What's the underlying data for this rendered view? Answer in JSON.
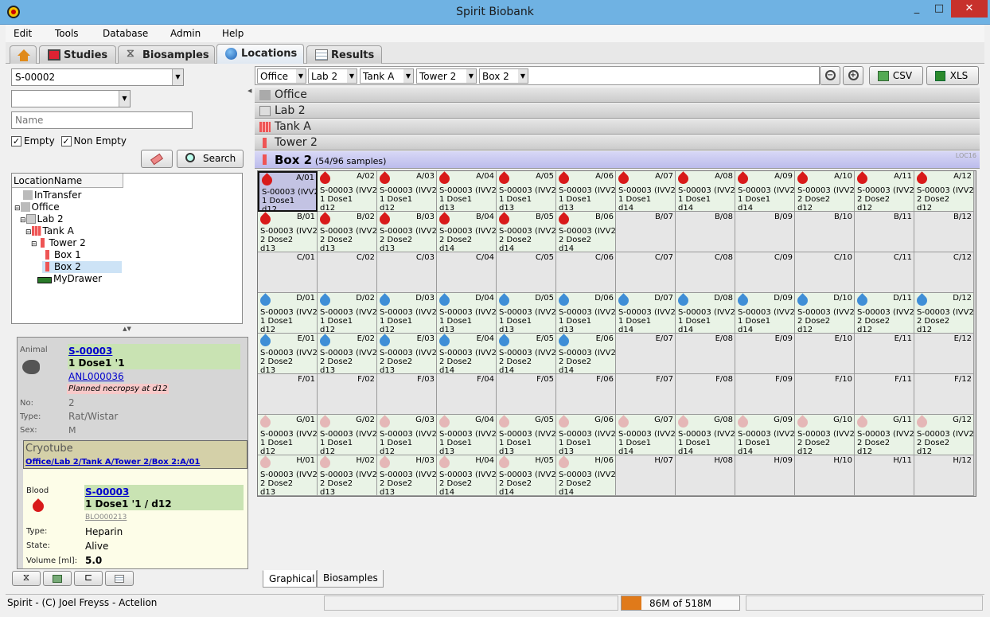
{
  "window": {
    "title": "Spirit Biobank",
    "min": "_",
    "max": "□",
    "close": "✕"
  },
  "menu": [
    "Edit",
    "Tools",
    "Database",
    "Admin",
    "Help"
  ],
  "tabs": [
    {
      "label": "",
      "icon": "home-icon"
    },
    {
      "label": "Studies",
      "icon": "studies-icon"
    },
    {
      "label": "Biosamples",
      "icon": "dna-icon"
    },
    {
      "label": "Locations",
      "icon": "globe-icon",
      "selected": true
    },
    {
      "label": "Results",
      "icon": "table-icon"
    }
  ],
  "search": {
    "sample_id": "S-00002",
    "type_value": "",
    "name_placeholder": "Name",
    "empty_label": "Empty",
    "empty_checked": true,
    "non_empty_label": "Non Empty",
    "non_empty_checked": true,
    "search_button": "Search"
  },
  "tree": {
    "header": "LocationName",
    "nodes": [
      "InTransfer",
      "Office",
      "Lab 2",
      "Tank A",
      "Tower 2",
      "Box 1",
      "Box 2",
      "MyDrawer"
    ],
    "selected": "Box 2"
  },
  "detail": {
    "animal_label": "Animal",
    "animal_id": "S-00003",
    "animal_group": "1 Dose1 '1",
    "animal_study": "ANL000036",
    "animal_note": "Planned necropsy at d12",
    "no_label": "No:",
    "no_value": "2",
    "type_label": "Type:",
    "type_value": "Rat/Wistar",
    "sex_label": "Sex:",
    "sex_value": "M",
    "container_label": "Cryotube",
    "container_path": "Office/Lab 2/Tank A/Tower 2/Box 2:A/01",
    "sample_label": "Blood",
    "sample_id": "S-00003",
    "sample_group": "1 Dose1 '1 / d12",
    "sample_code": "BLO000213",
    "stype_label": "Type:",
    "stype_value": "Heparin",
    "state_label": "State:",
    "state_value": "Alive",
    "volume_label": "Volume [ml]:",
    "volume_value": "5.0"
  },
  "filters": [
    "Office",
    "Lab 2",
    "Tank A",
    "Tower 2",
    "Box 2"
  ],
  "toolbar": {
    "csv": "CSV",
    "xls": "XLS"
  },
  "hierarchy": [
    {
      "label": "Office",
      "icon": "building-icon"
    },
    {
      "label": "Lab 2",
      "icon": "lab-icon"
    },
    {
      "label": "Tank A",
      "icon": "tank-icon"
    },
    {
      "label": "Tower 2",
      "icon": "tower-icon"
    }
  ],
  "box": {
    "title": "Box 2",
    "count": "(54/96 samples)",
    "code": "LOC16"
  },
  "grid": {
    "rows": [
      "A",
      "B",
      "C",
      "D",
      "E",
      "F",
      "G",
      "H"
    ],
    "cols": [
      "01",
      "02",
      "03",
      "04",
      "05",
      "06",
      "07",
      "08",
      "09",
      "10",
      "11",
      "12"
    ],
    "sample_line": "S-00003 (IVV2",
    "colors": {
      "red": "#d81a1a",
      "blue": "#3f8ed6",
      "pink": "#e5b7b7"
    },
    "rows_filled": [
      {
        "count": 12,
        "color": "red",
        "lines": [
          [
            "1 Dose1",
            "d12"
          ],
          [
            "1 Dose1",
            "d12"
          ],
          [
            "1 Dose1",
            "d12"
          ],
          [
            "1 Dose1",
            "d13"
          ],
          [
            "1 Dose1",
            "d13"
          ],
          [
            "1 Dose1",
            "d13"
          ],
          [
            "1 Dose1",
            "d14"
          ],
          [
            "1 Dose1",
            "d14"
          ],
          [
            "1 Dose1",
            "d14"
          ],
          [
            "2 Dose2",
            "d12"
          ],
          [
            "2 Dose2",
            "d12"
          ],
          [
            "2 Dose2",
            "d12"
          ]
        ]
      },
      {
        "count": 6,
        "color": "red",
        "lines": [
          [
            "2 Dose2",
            "d13"
          ],
          [
            "2 Dose2",
            "d13"
          ],
          [
            "2 Dose2",
            "d13"
          ],
          [
            "2 Dose2",
            "d14"
          ],
          [
            "2 Dose2",
            "d14"
          ],
          [
            "2 Dose2",
            "d14"
          ]
        ]
      },
      {
        "count": 0
      },
      {
        "count": 12,
        "color": "blue",
        "lines": [
          [
            "1 Dose1",
            "d12"
          ],
          [
            "1 Dose1",
            "d12"
          ],
          [
            "1 Dose1",
            "d12"
          ],
          [
            "1 Dose1",
            "d13"
          ],
          [
            "1 Dose1",
            "d13"
          ],
          [
            "1 Dose1",
            "d13"
          ],
          [
            "1 Dose1",
            "d14"
          ],
          [
            "1 Dose1",
            "d14"
          ],
          [
            "1 Dose1",
            "d14"
          ],
          [
            "2 Dose2",
            "d12"
          ],
          [
            "2 Dose2",
            "d12"
          ],
          [
            "2 Dose2",
            "d12"
          ]
        ]
      },
      {
        "count": 6,
        "color": "blue",
        "lines": [
          [
            "2 Dose2",
            "d13"
          ],
          [
            "2 Dose2",
            "d13"
          ],
          [
            "2 Dose2",
            "d13"
          ],
          [
            "2 Dose2",
            "d14"
          ],
          [
            "2 Dose2",
            "d14"
          ],
          [
            "2 Dose2",
            "d14"
          ]
        ]
      },
      {
        "count": 0
      },
      {
        "count": 12,
        "color": "pink",
        "lines": [
          [
            "1 Dose1",
            "d12"
          ],
          [
            "1 Dose1",
            "d12"
          ],
          [
            "1 Dose1",
            "d12"
          ],
          [
            "1 Dose1",
            "d13"
          ],
          [
            "1 Dose1",
            "d13"
          ],
          [
            "1 Dose1",
            "d13"
          ],
          [
            "1 Dose1",
            "d14"
          ],
          [
            "1 Dose1",
            "d14"
          ],
          [
            "1 Dose1",
            "d14"
          ],
          [
            "2 Dose2",
            "d12"
          ],
          [
            "2 Dose2",
            "d12"
          ],
          [
            "2 Dose2",
            "d12"
          ]
        ]
      },
      {
        "count": 6,
        "color": "pink",
        "lines": [
          [
            "2 Dose2",
            "d13"
          ],
          [
            "2 Dose2",
            "d13"
          ],
          [
            "2 Dose2",
            "d13"
          ],
          [
            "2 Dose2",
            "d14"
          ],
          [
            "2 Dose2",
            "d14"
          ],
          [
            "2 Dose2",
            "d14"
          ]
        ]
      }
    ],
    "selected": "A/01"
  },
  "view_tabs": [
    "Graphical",
    "Biosamples"
  ],
  "status": {
    "text": "Spirit - (C) Joel Freyss - Actelion",
    "memory": "86M of 518M",
    "memory_fraction": 0.17
  }
}
